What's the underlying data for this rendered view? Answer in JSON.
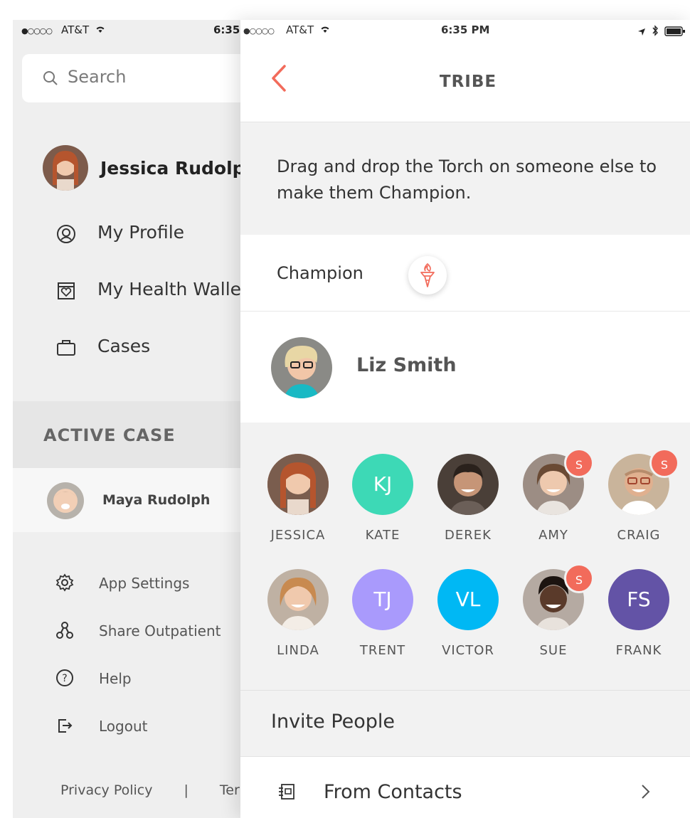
{
  "drawer": {
    "status": {
      "signal": "●○○○○",
      "carrier": "AT&T",
      "time": "6:35"
    },
    "search": {
      "placeholder": "Search"
    },
    "user": {
      "name": "Jessica Rudolph"
    },
    "menu": [
      {
        "label": "My Profile",
        "icon": "user-circle-icon"
      },
      {
        "label": "My Health Wallet",
        "icon": "wallet-icon"
      },
      {
        "label": "Cases",
        "icon": "briefcase-icon"
      }
    ],
    "active_case": {
      "heading": "ACTIVE CASE",
      "name": "Maya Rudolph"
    },
    "sub_menu": [
      {
        "label": "App Settings",
        "icon": "gear-icon"
      },
      {
        "label": "Share Outpatient",
        "icon": "share-nodes-icon"
      },
      {
        "label": "Help",
        "icon": "help-icon"
      },
      {
        "label": "Logout",
        "icon": "logout-icon"
      }
    ],
    "footer": {
      "privacy": "Privacy Policy",
      "separator": "|",
      "terms": "Terms"
    }
  },
  "panel": {
    "status": {
      "signal": "●○○○○",
      "carrier": "AT&T",
      "time": "6:35 PM"
    },
    "nav": {
      "title": "TRIBE"
    },
    "instructions": "Drag and drop the Torch on someone else to make them Champion.",
    "champion": {
      "label": "Champion",
      "name": "Liz Smith"
    },
    "members": [
      {
        "name": "JESSICA",
        "initials": "",
        "color": "#c27a5e",
        "badge": ""
      },
      {
        "name": "KATE",
        "initials": "KJ",
        "color": "#3dd9b6",
        "badge": ""
      },
      {
        "name": "DEREK",
        "initials": "",
        "color": "#5b4d44",
        "badge": ""
      },
      {
        "name": "AMY",
        "initials": "",
        "color": "#b9a08d",
        "badge": "S"
      },
      {
        "name": "CRAIG",
        "initials": "",
        "color": "#b79a7c",
        "badge": "S"
      },
      {
        "name": "LINDA",
        "initials": "",
        "color": "#d1a37e",
        "badge": ""
      },
      {
        "name": "TRENT",
        "initials": "TJ",
        "color": "#a99afc",
        "badge": ""
      },
      {
        "name": "VICTOR",
        "initials": "VL",
        "color": "#00b8f4",
        "badge": ""
      },
      {
        "name": "SUE",
        "initials": "",
        "color": "#5a4b44",
        "badge": "S"
      },
      {
        "name": "FRANK",
        "initials": "FS",
        "color": "#6353a6",
        "badge": ""
      }
    ],
    "invite": {
      "heading": "Invite People",
      "contacts_label": "From Contacts"
    }
  },
  "colors": {
    "accent": "#f26b5b",
    "background": "#f2f2f2"
  }
}
